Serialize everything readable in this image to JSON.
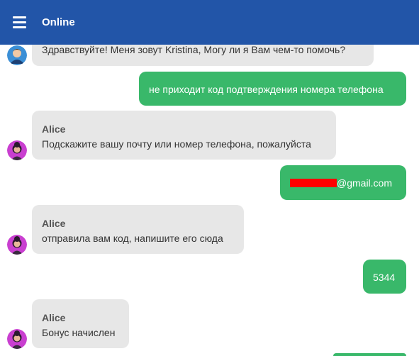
{
  "header": {
    "title": "Online",
    "menu_icon": "hamburger-menu-icon",
    "background": "#2255a8"
  },
  "messages": [
    {
      "from": "bot",
      "sender": "",
      "text": "Здравствуйте! Меня зовут Kristina, Могу ли я Вам чем-то помочь?"
    },
    {
      "from": "user",
      "text": "не приходит код подтверждения номера телефона"
    },
    {
      "from": "bot",
      "sender": "Alice",
      "text": "Подскажите вашу почту или номер телефона, пожалуйста"
    },
    {
      "from": "user",
      "text": "@gmail.com",
      "redacted_prefix": true
    },
    {
      "from": "bot",
      "sender": "Alice",
      "text": "отправила вам код, напишите его сюда"
    },
    {
      "from": "user",
      "text": "5344"
    },
    {
      "from": "bot",
      "sender": "Alice",
      "text": "Бонус начислен"
    }
  ],
  "colors": {
    "user_bubble": "#39b86a",
    "bot_bubble": "#e7e7e7",
    "redaction": "#ff0000"
  }
}
